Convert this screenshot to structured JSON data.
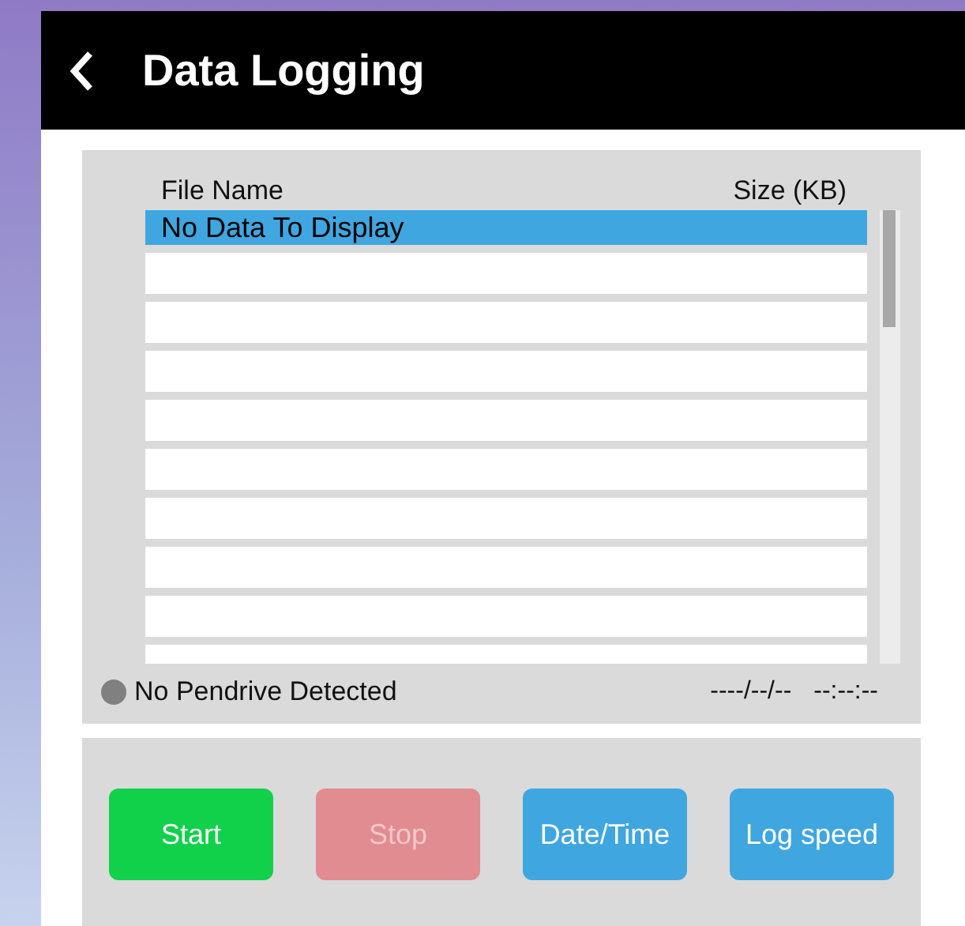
{
  "header": {
    "title": "Data Logging"
  },
  "table": {
    "columns": [
      "File Name",
      "Size (KB)"
    ],
    "rows": [
      {
        "file_name": "No Data To Display",
        "selected": true
      }
    ]
  },
  "status": {
    "indicator": {
      "color": "#808080"
    },
    "message": "No Pendrive Detected",
    "date": "----/--/--",
    "time": "--:--:--"
  },
  "buttons": [
    {
      "label": "Start",
      "color": "#11d04a",
      "disabled": false
    },
    {
      "label": "Stop",
      "color": "#e08c90",
      "disabled": true
    },
    {
      "label": "Date/Time",
      "color": "#3fa6e0",
      "disabled": false
    },
    {
      "label": "Log speed",
      "color": "#3fa6e0",
      "disabled": false
    }
  ]
}
